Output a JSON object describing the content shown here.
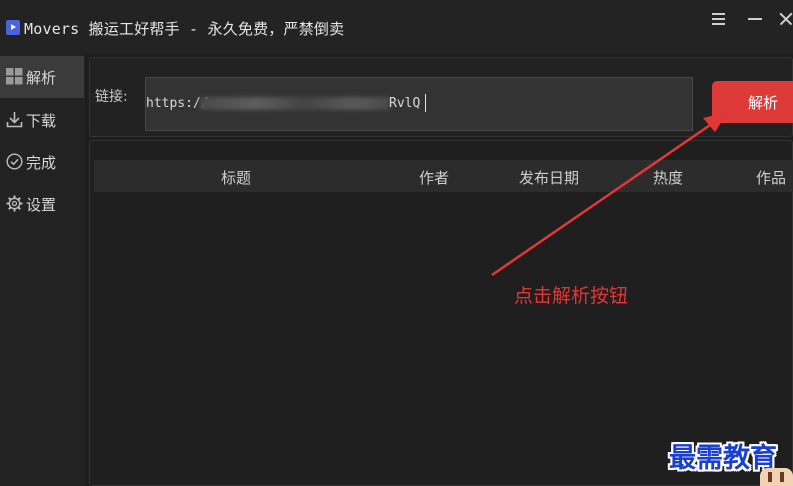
{
  "window": {
    "title": "Movers 搬运工好帮手 - 永久免费，严禁倒卖",
    "logo_icon": "play-icon",
    "controls": [
      "menu-icon",
      "minimize-icon",
      "close-icon"
    ]
  },
  "sidebar": {
    "items": [
      {
        "label": "解析",
        "icon": "grid-icon",
        "active": true
      },
      {
        "label": "下载",
        "icon": "download-icon",
        "active": false
      },
      {
        "label": "完成",
        "icon": "check-circle-icon",
        "active": false
      },
      {
        "label": "设置",
        "icon": "gear-icon",
        "active": false
      }
    ]
  },
  "link": {
    "label": "链接:",
    "value_start": "https://",
    "value_end": "RvlQ",
    "parse_button": "解析"
  },
  "table": {
    "columns": [
      "标题",
      "作者",
      "发布日期",
      "热度",
      "作品"
    ],
    "rows": []
  },
  "annotation": {
    "text": "点击解析按钮",
    "color": "#e53636"
  },
  "watermark": {
    "text": "最需教育"
  },
  "colors": {
    "accent": "#de3a3a",
    "background": "#1e1e1e",
    "watermark": "#1a3fd1"
  }
}
